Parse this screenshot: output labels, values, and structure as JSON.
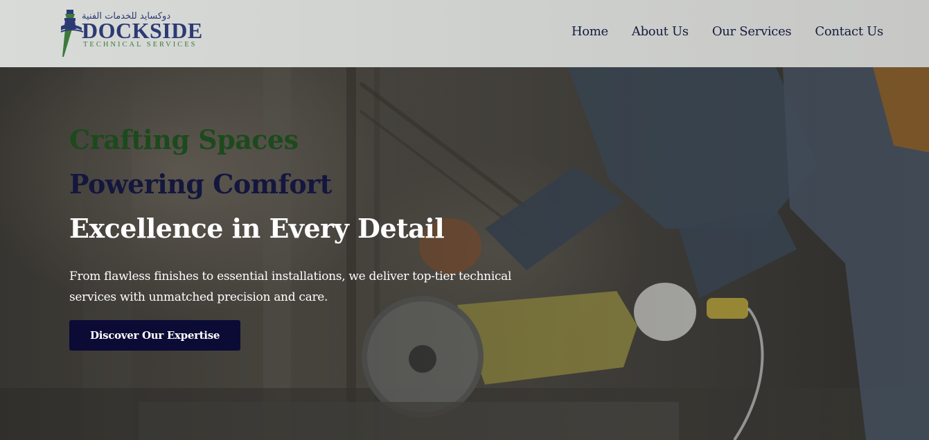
{
  "brand": {
    "arabic_name": "دوكسايد للخدمات الفنية",
    "name": "DOCKSIDE",
    "tagline": "TECHNICAL SERVICES"
  },
  "nav": {
    "items": [
      {
        "label": "Home"
      },
      {
        "label": "About Us"
      },
      {
        "label": "Our Services"
      },
      {
        "label": "Contact Us"
      }
    ]
  },
  "hero": {
    "headline_1": "Crafting Spaces",
    "headline_2": "Powering Comfort",
    "headline_3": "Excellence in Every Detail",
    "description": "From flawless finishes to essential installations, we deliver top-tier technical services with unmatched precision and care.",
    "cta_label": "Discover Our Expertise"
  },
  "colors": {
    "headline_green": "#1c4a1c",
    "headline_navy": "#14163e",
    "cta_background": "#0c0b36",
    "nav_text": "#141a3c",
    "brand_blue": "#2c3a74",
    "brand_green": "#3c7a3a"
  },
  "icons": {
    "logo_mark": "lighthouse-logo-icon"
  }
}
